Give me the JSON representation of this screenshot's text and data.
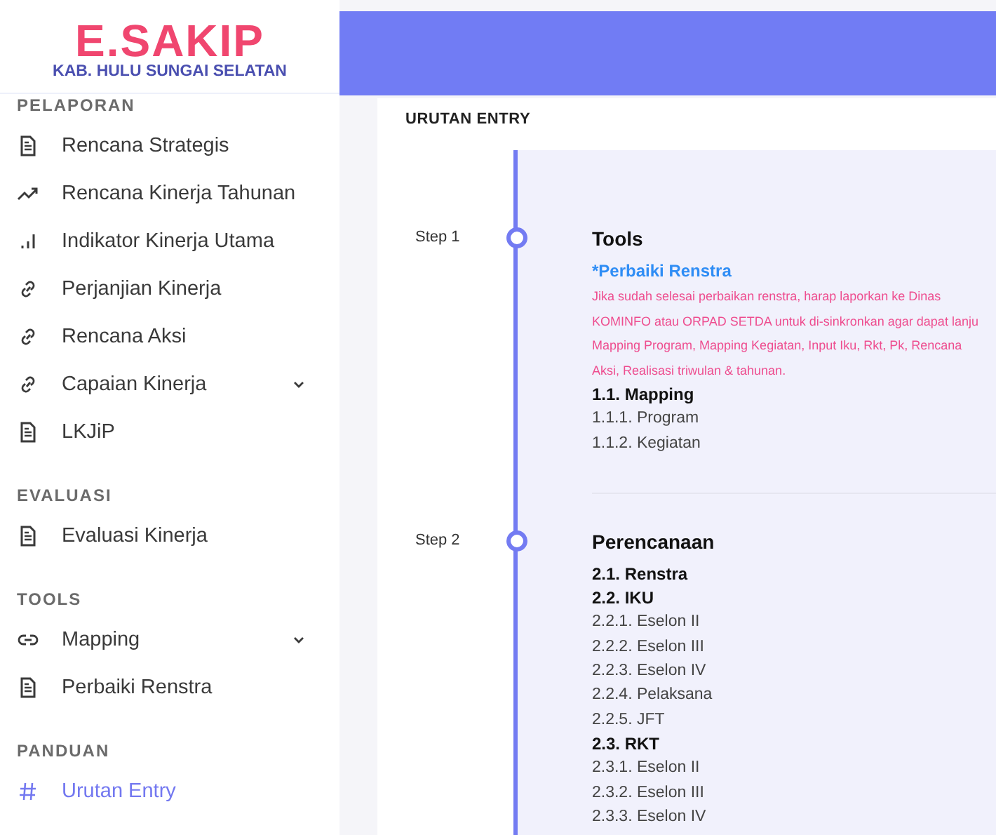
{
  "logo": {
    "title": "E.SAKIP",
    "subtitle": "KAB. HULU SUNGAI SELATAN"
  },
  "sidebar": {
    "sections": [
      {
        "heading": "PELAPORAN",
        "items": [
          {
            "label": "Rencana Strategis",
            "kind": "document",
            "expandable": false,
            "selected": false
          },
          {
            "label": "Rencana Kinerja Tahunan",
            "kind": "trend",
            "expandable": false,
            "selected": false
          },
          {
            "label": "Indikator Kinerja Utama",
            "kind": "bars",
            "expandable": false,
            "selected": false
          },
          {
            "label": "Perjanjian Kinerja",
            "kind": "link",
            "expandable": false,
            "selected": false
          },
          {
            "label": "Rencana Aksi",
            "kind": "link",
            "expandable": false,
            "selected": false
          },
          {
            "label": "Capaian Kinerja",
            "kind": "link",
            "expandable": true,
            "selected": false
          },
          {
            "label": "LKJiP",
            "kind": "document",
            "expandable": false,
            "selected": false
          }
        ]
      },
      {
        "heading": "EVALUASI",
        "items": [
          {
            "label": "Evaluasi Kinerja",
            "kind": "document",
            "expandable": false,
            "selected": false
          }
        ]
      },
      {
        "heading": "TOOLS",
        "items": [
          {
            "label": "Mapping",
            "kind": "chain",
            "expandable": true,
            "selected": false
          },
          {
            "label": "Perbaiki Renstra",
            "kind": "document",
            "expandable": false,
            "selected": false
          }
        ]
      },
      {
        "heading": "PANDUAN",
        "items": [
          {
            "label": "Urutan Entry",
            "kind": "hash",
            "expandable": false,
            "selected": true
          }
        ]
      }
    ]
  },
  "page": {
    "title": "URUTAN ENTRY",
    "steps": [
      {
        "label": "Step 1",
        "title": "Tools",
        "link": "*Perbaiki Renstra",
        "note": [
          "Jika sudah selesai perbaikan renstra, harap laporkan ke Dinas",
          "KOMINFO atau ORPAD SETDA untuk di-sinkronkan agar dapat lanju",
          "Mapping Program, Mapping Kegiatan, Input Iku, Rkt, Pk, Rencana",
          "Aksi, Realisasi triwulan & tahunan."
        ],
        "entries": [
          {
            "text": "1.1. Mapping",
            "bold": true
          },
          {
            "text": "1.1.1. Program",
            "bold": false
          },
          {
            "text": "1.1.2. Kegiatan",
            "bold": false
          }
        ]
      },
      {
        "label": "Step 2",
        "title": "Perencanaan",
        "entries": [
          {
            "text": "2.1. Renstra",
            "bold": true
          },
          {
            "text": "2.2. IKU",
            "bold": true
          },
          {
            "text": "2.2.1. Eselon II",
            "bold": false
          },
          {
            "text": "2.2.2. Eselon III",
            "bold": false
          },
          {
            "text": "2.2.3. Eselon IV",
            "bold": false
          },
          {
            "text": "2.2.4. Pelaksana",
            "bold": false
          },
          {
            "text": "2.2.5. JFT",
            "bold": false
          },
          {
            "text": "2.3. RKT",
            "bold": true
          },
          {
            "text": "2.3.1. Eselon II",
            "bold": false
          },
          {
            "text": "2.3.2. Eselon III",
            "bold": false
          },
          {
            "text": "2.3.3. Eselon IV",
            "bold": false
          }
        ]
      }
    ]
  }
}
